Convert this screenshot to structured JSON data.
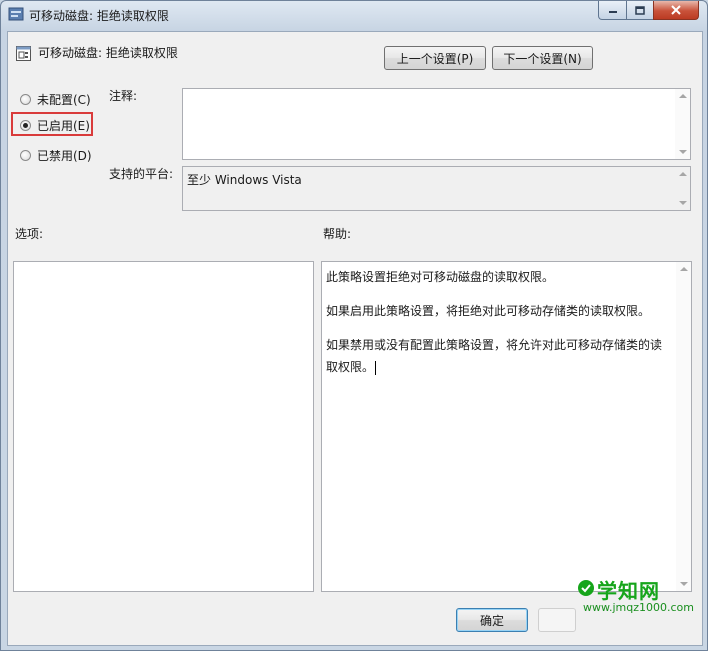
{
  "window": {
    "title": "可移动磁盘: 拒绝读取权限",
    "controls": {
      "minimize": "minimize-icon",
      "maximize": "maximize-icon",
      "close": "close-icon"
    }
  },
  "header": {
    "policy_name": "可移动磁盘: 拒绝读取权限",
    "prev_button": "上一个设置(P)",
    "next_button": "下一个设置(N)"
  },
  "state": {
    "options": [
      {
        "label": "未配置(C)",
        "checked": false
      },
      {
        "label": "已启用(E)",
        "checked": true
      },
      {
        "label": "已禁用(D)",
        "checked": false
      }
    ]
  },
  "comment": {
    "label": "注释:",
    "value": ""
  },
  "platform": {
    "label": "支持的平台:",
    "value": "至少 Windows Vista"
  },
  "options_section": {
    "label": "选项:"
  },
  "help_section": {
    "label": "帮助:",
    "paragraphs": [
      "此策略设置拒绝对可移动磁盘的读取权限。",
      "如果启用此策略设置，将拒绝对此可移动存储类的读取权限。",
      "如果禁用或没有配置此策略设置，将允许对此可移动存储类的读取权限。"
    ]
  },
  "footer": {
    "ok_button": "确定"
  },
  "watermark": {
    "title": "学知网",
    "url": "www.jmqz1000.com"
  },
  "colors": {
    "highlight": "#d93b3b",
    "watermark": "#16a51b"
  }
}
